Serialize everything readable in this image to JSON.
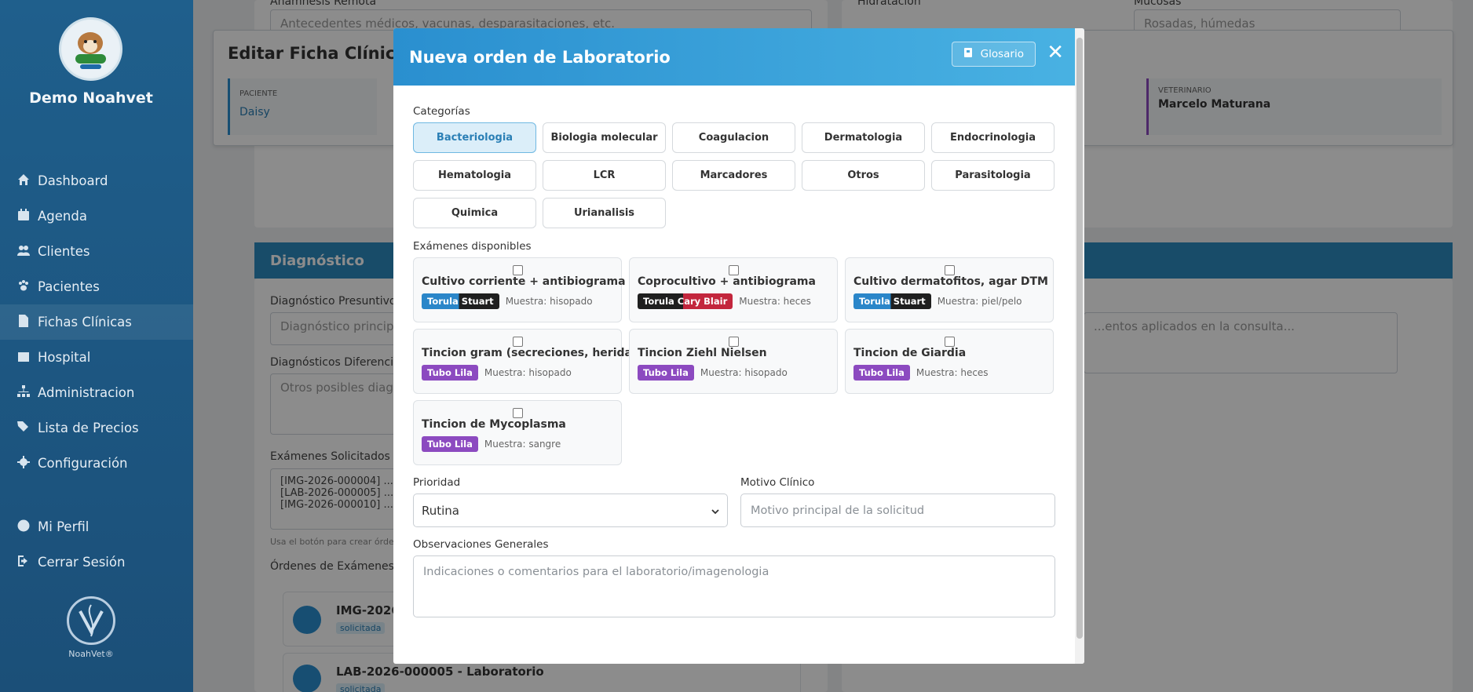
{
  "sidebar": {
    "brand": "Demo Noahvet",
    "items": [
      {
        "label": "Dashboard",
        "icon": "home-icon"
      },
      {
        "label": "Agenda",
        "icon": "calendar-icon"
      },
      {
        "label": "Clientes",
        "icon": "users-icon"
      },
      {
        "label": "Pacientes",
        "icon": "paw-icon"
      },
      {
        "label": "Fichas Clínicas",
        "icon": "file-medical-icon"
      },
      {
        "label": "Hospital",
        "icon": "hospital-icon"
      },
      {
        "label": "Administracion",
        "icon": "sitemap-icon"
      },
      {
        "label": "Lista de Precios",
        "icon": "tags-icon"
      },
      {
        "label": "Configuración",
        "icon": "gear-icon"
      }
    ],
    "items2": [
      {
        "label": "Mi Perfil",
        "icon": "user-circle-icon"
      },
      {
        "label": "Cerrar Sesión",
        "icon": "logout-icon"
      }
    ],
    "footer": "NoahVet®"
  },
  "background": {
    "anamnesis_label": "Anamnesis Remota",
    "anamnesis_placeholder": "Antecedentes médicos, vacunas, desparasitaciones, etc.",
    "hidratacion_label": "Hidratación",
    "mucosas_label": "Mucosas",
    "mucosas_placeholder": "Rosadas, húmedas",
    "edit_title": "Editar Ficha Clínica",
    "paciente_label": "PACIENTE",
    "paciente_value": "Daisy",
    "veterinario_label": "VETERINARIO",
    "veterinario_value": "Marcelo Maturana",
    "diagnostico_title": "Diagnóstico",
    "diag_presuntivo_label": "Diagnóstico Presuntivo",
    "diag_presuntivo_ph": "Diagnóstico principal",
    "diag_dif_label": "Diagnósticos Diferenciales",
    "diag_dif_ph": "Otros posibles diagnósticos",
    "tratamientos_ph": "...entos aplicados en la consulta...",
    "examenes_label": "Exámenes Solicitados",
    "examenes_lines": [
      "[IMG-2026-000004] ...",
      "[LAB-2026-000005] ...",
      "[IMG-2026-000010] ..."
    ],
    "examenes_hint": "Usa el botón para crear órdenes...",
    "ordenes_label": "Órdenes de Exámenes ...",
    "order1": "IMG-2026-...",
    "order1_status": "solicitada",
    "order2": "LAB-2026-000005 - Laboratorio",
    "order2_status": "solicitada"
  },
  "modal": {
    "title": "Nueva orden de Laboratorio",
    "glossary_label": "Glosario",
    "categories_label": "Categorías",
    "categories": [
      "Bacteriologia",
      "Biologia molecular",
      "Coagulacion",
      "Dermatologia",
      "Endocrinologia",
      "Hematologia",
      "LCR",
      "Marcadores",
      "Otros",
      "Parasitologia",
      "Quimica",
      "Urianalisis"
    ],
    "active_category": "Bacteriologia",
    "exams_label": "Exámenes disponibles",
    "exams": [
      {
        "name": "Cultivo corriente + antibiograma",
        "tube": "Torula Stuart",
        "tube_style": "split-blue",
        "sample": "Muestra: hisopado"
      },
      {
        "name": "Coprocultivo + antibiograma",
        "tube": "Torula Cary Blair",
        "tube_style": "split-red",
        "sample": "Muestra: heces"
      },
      {
        "name": "Cultivo dermatofitos, agar DTM",
        "tube": "Torula Stuart",
        "tube_style": "split-blue",
        "sample": "Muestra: piel/pelo"
      },
      {
        "name": "Tincion gram (secreciones, heridas)",
        "tube": "Tubo Lila",
        "tube_style": "lila",
        "sample": "Muestra: hisopado"
      },
      {
        "name": "Tincion Ziehl Nielsen",
        "tube": "Tubo Lila",
        "tube_style": "lila",
        "sample": "Muestra: hisopado"
      },
      {
        "name": "Tincion de Giardia",
        "tube": "Tubo Lila",
        "tube_style": "lila",
        "sample": "Muestra: heces"
      },
      {
        "name": "Tincion de Mycoplasma",
        "tube": "Tubo Lila",
        "tube_style": "lila",
        "sample": "Muestra: sangre"
      }
    ],
    "prioridad_label": "Prioridad",
    "prioridad_value": "Rutina",
    "motivo_label": "Motivo Clínico",
    "motivo_placeholder": "Motivo principal de la solicitud",
    "obs_label": "Observaciones Generales",
    "obs_placeholder": "Indicaciones o comentarios para el laboratorio/imagenologia"
  },
  "colors": {
    "header_start": "#2a8fcf",
    "header_end": "#49b2e3",
    "sidebar": "#1f5f8c",
    "lila": "#8c4ac0"
  }
}
